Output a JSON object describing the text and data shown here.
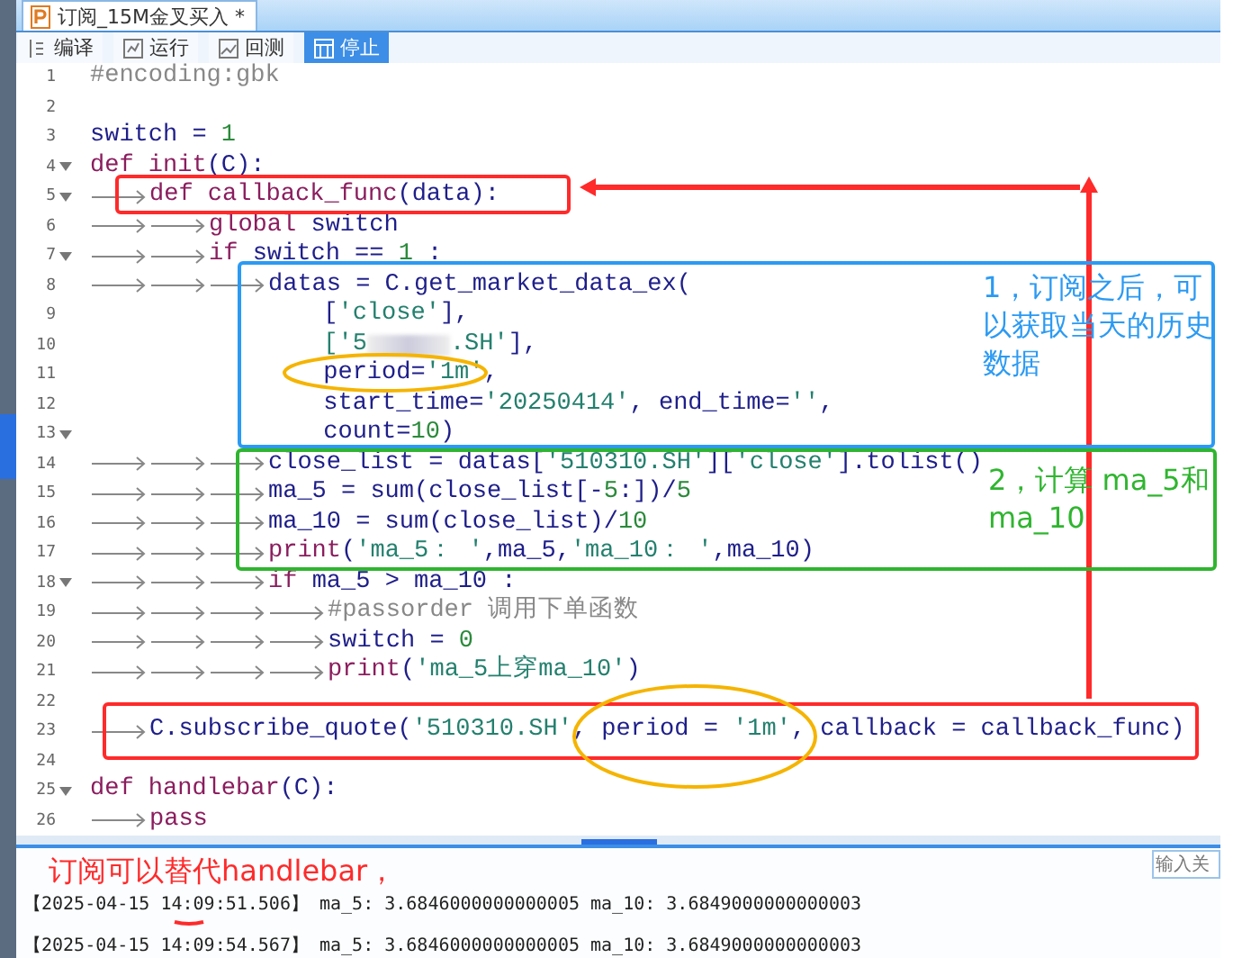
{
  "tab": {
    "title": "订阅_15M金叉买入",
    "modified_mark": "*"
  },
  "toolbar": [
    {
      "label": "编译",
      "selected": false
    },
    {
      "label": "运行",
      "selected": false
    },
    {
      "label": "回测",
      "selected": false
    },
    {
      "label": "停止",
      "selected": true
    }
  ],
  "code_lines": [
    {
      "number": "1",
      "foldable": false,
      "segments": [
        {
          "kind": "comment",
          "text": "#encoding:gbk"
        }
      ]
    },
    {
      "number": "2",
      "foldable": false
    },
    {
      "number": "3",
      "foldable": false,
      "segments": [
        {
          "kind": "name",
          "text": "switch = "
        },
        {
          "kind": "number",
          "text": "1"
        }
      ]
    },
    {
      "number": "4",
      "foldable": true,
      "segments": [
        {
          "kind": "keyword",
          "text": "def init"
        },
        {
          "kind": "name",
          "text": "(C):"
        }
      ]
    },
    {
      "number": "5",
      "foldable": true,
      "segments": [
        {
          "kind": "tab"
        },
        {
          "kind": "keyword",
          "text": "def callback_func"
        },
        {
          "kind": "name",
          "text": "(data):"
        }
      ]
    },
    {
      "number": "6",
      "foldable": false,
      "segments": [
        {
          "kind": "tab"
        },
        {
          "kind": "tab"
        },
        {
          "kind": "keyword",
          "text": "global "
        },
        {
          "kind": "name",
          "text": "switch"
        }
      ]
    },
    {
      "number": "7",
      "foldable": true,
      "segments": [
        {
          "kind": "tab"
        },
        {
          "kind": "tab"
        },
        {
          "kind": "keyword",
          "text": "if "
        },
        {
          "kind": "name",
          "text": "switch == "
        },
        {
          "kind": "number",
          "text": "1"
        },
        {
          "kind": "name",
          "text": " :"
        }
      ]
    },
    {
      "number": "8",
      "foldable": false,
      "segments": [
        {
          "kind": "tab"
        },
        {
          "kind": "tab"
        },
        {
          "kind": "tab"
        },
        {
          "kind": "name",
          "text": "datas = C.get_market_data_ex("
        }
      ]
    },
    {
      "number": "9",
      "foldable": false,
      "segments": [
        {
          "kind": "name",
          "text": "                ["
        },
        {
          "kind": "string",
          "text": "'close'"
        },
        {
          "kind": "name",
          "text": "],"
        }
      ]
    },
    {
      "number": "10",
      "foldable": false,
      "segments": [
        {
          "kind": "string",
          "text": "                ['5"
        },
        {
          "kind": "redacted"
        },
        {
          "kind": "string",
          "text": ".SH'"
        },
        {
          "kind": "name",
          "text": "],"
        }
      ]
    },
    {
      "number": "11",
      "foldable": false,
      "segments": [
        {
          "kind": "name",
          "text": "                period="
        },
        {
          "kind": "string",
          "text": "'1m'"
        },
        {
          "kind": "name",
          "text": ","
        }
      ]
    },
    {
      "number": "12",
      "foldable": false,
      "segments": [
        {
          "kind": "name",
          "text": "                start_time="
        },
        {
          "kind": "string",
          "text": "'20250414'"
        },
        {
          "kind": "name",
          "text": ", end_time="
        },
        {
          "kind": "string",
          "text": "''"
        },
        {
          "kind": "name",
          "text": ","
        }
      ]
    },
    {
      "number": "13",
      "foldable": true,
      "segments": [
        {
          "kind": "name",
          "text": "                count="
        },
        {
          "kind": "number",
          "text": "10"
        },
        {
          "kind": "name",
          "text": ")"
        }
      ]
    },
    {
      "number": "14",
      "foldable": false,
      "segments": [
        {
          "kind": "tab"
        },
        {
          "kind": "tab"
        },
        {
          "kind": "tab"
        },
        {
          "kind": "name",
          "text": "close_list = datas["
        },
        {
          "kind": "string",
          "text": "'510310.SH'"
        },
        {
          "kind": "name",
          "text": "]["
        },
        {
          "kind": "string",
          "text": "'close'"
        },
        {
          "kind": "name",
          "text": "].tolist()"
        }
      ]
    },
    {
      "number": "15",
      "foldable": false,
      "segments": [
        {
          "kind": "tab"
        },
        {
          "kind": "tab"
        },
        {
          "kind": "tab"
        },
        {
          "kind": "name",
          "text": "ma_5 = sum(close_list[-"
        },
        {
          "kind": "number",
          "text": "5"
        },
        {
          "kind": "name",
          "text": ":])/"
        },
        {
          "kind": "number",
          "text": "5"
        }
      ]
    },
    {
      "number": "16",
      "foldable": false,
      "segments": [
        {
          "kind": "tab"
        },
        {
          "kind": "tab"
        },
        {
          "kind": "tab"
        },
        {
          "kind": "name",
          "text": "ma_10 = sum(close_list)/"
        },
        {
          "kind": "number",
          "text": "10"
        }
      ]
    },
    {
      "number": "17",
      "foldable": false,
      "segments": [
        {
          "kind": "tab"
        },
        {
          "kind": "tab"
        },
        {
          "kind": "tab"
        },
        {
          "kind": "keyword",
          "text": "print"
        },
        {
          "kind": "name",
          "text": "("
        },
        {
          "kind": "string",
          "text": "'ma_5： '"
        },
        {
          "kind": "name",
          "text": ",ma_5,"
        },
        {
          "kind": "string",
          "text": "'ma_10： '"
        },
        {
          "kind": "name",
          "text": ",ma_10)"
        }
      ]
    },
    {
      "number": "18",
      "foldable": true,
      "segments": [
        {
          "kind": "tab"
        },
        {
          "kind": "tab"
        },
        {
          "kind": "tab"
        },
        {
          "kind": "keyword",
          "text": "if "
        },
        {
          "kind": "name",
          "text": "ma_5 > ma_10 :"
        }
      ]
    },
    {
      "number": "19",
      "foldable": false,
      "segments": [
        {
          "kind": "tab"
        },
        {
          "kind": "tab"
        },
        {
          "kind": "tab"
        },
        {
          "kind": "tab"
        },
        {
          "kind": "comment",
          "text": "#passorder 调用下单函数"
        }
      ]
    },
    {
      "number": "20",
      "foldable": false,
      "segments": [
        {
          "kind": "tab"
        },
        {
          "kind": "tab"
        },
        {
          "kind": "tab"
        },
        {
          "kind": "tab"
        },
        {
          "kind": "name",
          "text": "switch = "
        },
        {
          "kind": "number",
          "text": "0"
        }
      ]
    },
    {
      "number": "21",
      "foldable": false,
      "segments": [
        {
          "kind": "tab"
        },
        {
          "kind": "tab"
        },
        {
          "kind": "tab"
        },
        {
          "kind": "tab"
        },
        {
          "kind": "keyword",
          "text": "print"
        },
        {
          "kind": "name",
          "text": "("
        },
        {
          "kind": "string",
          "text": "'ma_5上穿ma_10'"
        },
        {
          "kind": "name",
          "text": ")"
        }
      ]
    },
    {
      "number": "22",
      "foldable": false
    },
    {
      "number": "23",
      "foldable": false,
      "segments": [
        {
          "kind": "tab"
        },
        {
          "kind": "name",
          "text": "C.subscribe_quote("
        },
        {
          "kind": "string",
          "text": "'510310.SH'"
        },
        {
          "kind": "name",
          "text": ", period = "
        },
        {
          "kind": "string",
          "text": "'1m'"
        },
        {
          "kind": "name",
          "text": ", callback = callback_func)"
        }
      ]
    },
    {
      "number": "24",
      "foldable": false
    },
    {
      "number": "25",
      "foldable": true,
      "segments": [
        {
          "kind": "keyword",
          "text": "def handlebar"
        },
        {
          "kind": "name",
          "text": "(C):"
        }
      ]
    },
    {
      "number": "26",
      "foldable": false,
      "segments": [
        {
          "kind": "tab"
        },
        {
          "kind": "keyword",
          "text": "pass"
        }
      ]
    }
  ],
  "log": {
    "search_placeholder": "输入关",
    "lines": [
      "【2025-04-15 14:09:51.506】 ma_5: 3.6846000000000005 ma_10: 3.6849000000000003",
      "【2025-04-15 14:09:54.567】 ma_5: 3.6846000000000005 ma_10: 3.6849000000000003"
    ]
  },
  "annotations": [
    {
      "kind": "box",
      "color": "#ff2a2a"
    },
    {
      "kind": "arrow",
      "color": "#ff2a2a"
    },
    {
      "kind": "arrow",
      "color": "#ff2a2a"
    },
    {
      "kind": "box",
      "color": "#2b9af3"
    },
    {
      "kind": "note",
      "color": "#2b9af3",
      "text": "1，订阅之后，可以获取当天的历史数据"
    },
    {
      "kind": "ellipse",
      "color": "#f5b400"
    },
    {
      "kind": "box",
      "color": "#2fb52f"
    },
    {
      "kind": "note",
      "color": "#2fb52f",
      "text": "2，计算 ma_5和ma_10"
    },
    {
      "kind": "box",
      "color": "#ff2a2a"
    },
    {
      "kind": "ellipse",
      "color": "#f5b400"
    },
    {
      "kind": "note",
      "color": "#ff2a2a",
      "text": "订阅可以替代handlebar，"
    },
    {
      "kind": "underline",
      "color": "#ff2a2a"
    }
  ]
}
